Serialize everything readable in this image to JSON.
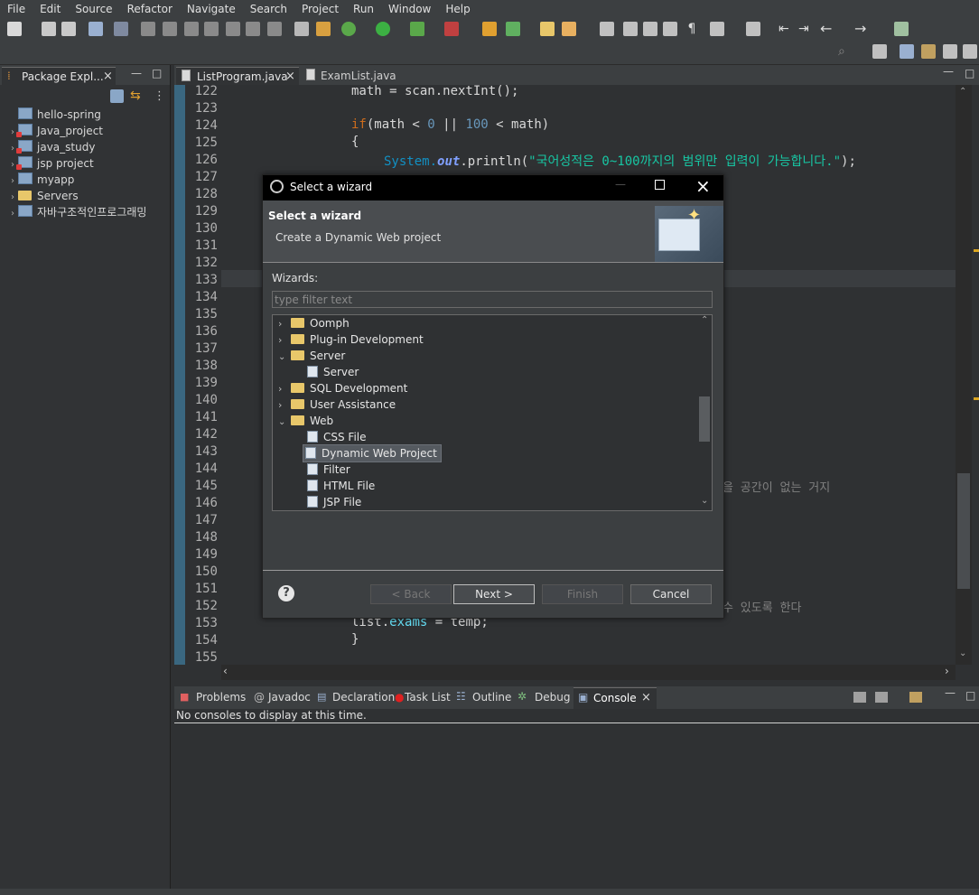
{
  "menu": [
    "File",
    "Edit",
    "Source",
    "Refactor",
    "Navigate",
    "Search",
    "Project",
    "Run",
    "Window",
    "Help"
  ],
  "package_explorer": {
    "tab_label": "Package Expl...",
    "projects": [
      {
        "name": "hello-spring",
        "expandable": false,
        "error": false
      },
      {
        "name": "Java_project",
        "expandable": true,
        "error": true
      },
      {
        "name": "java_study",
        "expandable": true,
        "error": true
      },
      {
        "name": "jsp project",
        "expandable": true,
        "error": true
      },
      {
        "name": "myapp",
        "expandable": true,
        "error": false
      },
      {
        "name": "Servers",
        "expandable": true,
        "error": false
      },
      {
        "name": "자바구조적인프로그래밍",
        "expandable": true,
        "error": false
      }
    ]
  },
  "editor": {
    "tabs": [
      {
        "label": "ListProgram.java",
        "active": true
      },
      {
        "label": "ExamList.java",
        "active": false
      }
    ],
    "line_numbers": [
      "122",
      "123",
      "124",
      "125",
      "126",
      "127",
      "128",
      "129",
      "130",
      "131",
      "132",
      "133",
      "134",
      "135",
      "136",
      "137",
      "138",
      "139",
      "140",
      "141",
      "142",
      "143",
      "144",
      "145",
      "146",
      "147",
      "148",
      "149",
      "150",
      "151",
      "152",
      "153",
      "154",
      "155"
    ],
    "line_122": "math = scan.nextInt();",
    "line_124_if": "if",
    "line_124_rest_a": "(math < ",
    "line_124_zero": "0",
    "line_124_rest_b": " || ",
    "line_124_hundred": "100",
    "line_124_rest_c": " < math)",
    "line_125": "{",
    "line_126_sys": "System.",
    "line_126_out": "out",
    "line_126_println": ".println(",
    "line_126_str": "\"국어성적은 0~100까지의 범위만 입력이 가능합니다.\"",
    "line_126_end": ");",
    "line_145_tail": "을 공간이 없는 거지",
    "line_152_tail": "수 있도록 한다",
    "line_153_list": "list.",
    "line_153_exams": "exams",
    "line_153_rest": " = temp;",
    "line_154": "}"
  },
  "bottom_panel": {
    "tabs": [
      "Problems",
      "Javadoc",
      "Declaration",
      "Task List",
      "Outline",
      "Debug",
      "Console"
    ],
    "active_tab": "Console",
    "message": "No consoles to display at this time."
  },
  "dialog": {
    "window_title": "Select a wizard",
    "header_title": "Select a wizard",
    "header_desc": "Create a Dynamic Web project",
    "wizards_label": "Wizards:",
    "filter_placeholder": "type filter text",
    "tree": [
      {
        "label": "Oomph",
        "type": "folder",
        "expanded": false,
        "level": 0
      },
      {
        "label": "Plug-in Development",
        "type": "folder",
        "expanded": false,
        "level": 0
      },
      {
        "label": "Server",
        "type": "folder",
        "expanded": true,
        "level": 0
      },
      {
        "label": "Server",
        "type": "item",
        "level": 1
      },
      {
        "label": "SQL Development",
        "type": "folder",
        "expanded": false,
        "level": 0
      },
      {
        "label": "User Assistance",
        "type": "folder",
        "expanded": false,
        "level": 0
      },
      {
        "label": "Web",
        "type": "folder",
        "expanded": true,
        "level": 0
      },
      {
        "label": "CSS File",
        "type": "item",
        "level": 1
      },
      {
        "label": "Dynamic Web Project",
        "type": "item",
        "level": 1,
        "selected": true
      },
      {
        "label": "Filter",
        "type": "item",
        "level": 1
      },
      {
        "label": "HTML File",
        "type": "item",
        "level": 1
      },
      {
        "label": "JSP File",
        "type": "item",
        "level": 1
      }
    ],
    "buttons": {
      "back": "< Back",
      "next": "Next >",
      "finish": "Finish",
      "cancel": "Cancel",
      "help": "?"
    }
  },
  "colors": {
    "background": "#2f3133",
    "panel": "#3c3f41",
    "keyword": "#cc6c1d",
    "string": "#17c6a3",
    "number": "#6897bb"
  }
}
